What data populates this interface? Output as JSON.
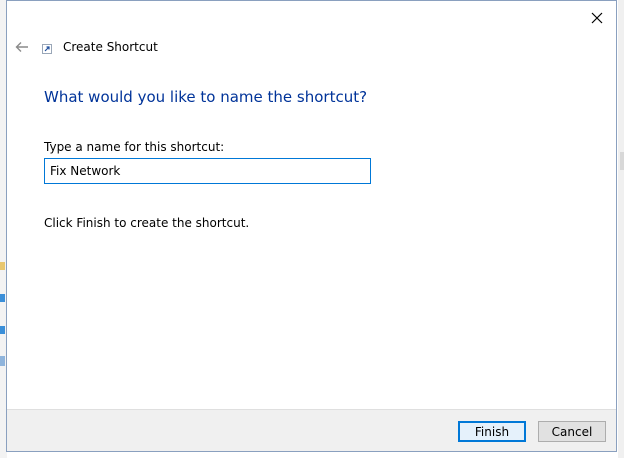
{
  "dialog": {
    "title": "Create Shortcut",
    "heading": "What would you like to name the shortcut?",
    "name_label": "Type a name for this shortcut:",
    "name_value": "Fix Network",
    "info_text": "Click Finish to create the shortcut.",
    "buttons": {
      "finish": "Finish",
      "cancel": "Cancel"
    },
    "icons": {
      "close": "close-icon",
      "back": "back-arrow-icon",
      "wizard": "shortcut-icon"
    }
  },
  "colors": {
    "heading": "#003399",
    "focus_border": "#0078d7",
    "footer_bg": "#f0f0f0"
  }
}
